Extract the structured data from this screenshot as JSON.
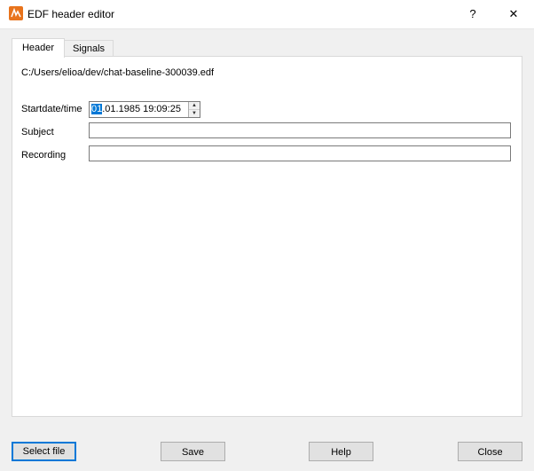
{
  "window": {
    "title": "EDF header editor",
    "help_glyph": "?",
    "close_glyph": "✕"
  },
  "tabs": [
    {
      "label": "Header",
      "active": true
    },
    {
      "label": "Signals",
      "active": false
    }
  ],
  "header": {
    "file_path": "C:/Users/elioa/dev/chat-baseline-300039.edf",
    "startdate_label": "Startdate/time",
    "startdate_selected": "01",
    "startdate_rest": ".01.1985 19:09:25",
    "subject_label": "Subject",
    "subject_value": "",
    "recording_label": "Recording",
    "recording_value": ""
  },
  "buttons": {
    "select_file": "Select file",
    "save": "Save",
    "help": "Help",
    "close": "Close"
  },
  "colors": {
    "app_icon": "#e8731c",
    "selection": "#0078d7"
  }
}
